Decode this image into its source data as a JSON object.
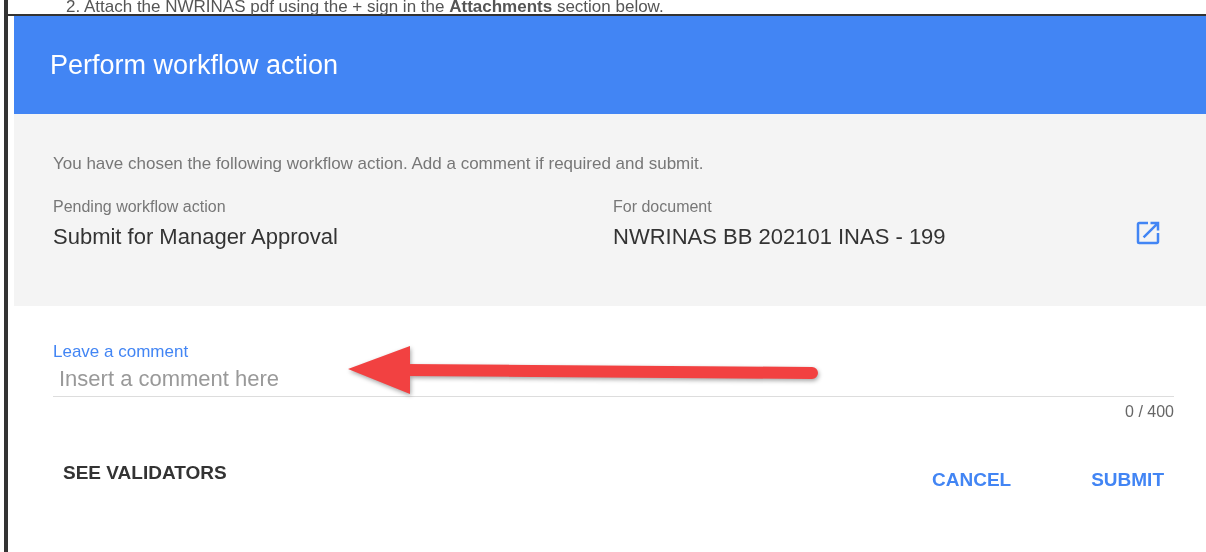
{
  "background_text": "2. Attach the NWRINAS pdf using the + sign in the **Attachments** section below.",
  "dialog": {
    "title": "Perform workflow action",
    "intro": "You have chosen the following workflow action. Add a comment if required and submit.",
    "details": [
      {
        "label": "Pending workflow action",
        "value": "Submit for Manager Approval",
        "kind": "text"
      },
      {
        "label": "For document",
        "value": "NWRINAS BB 202101 INAS - 199",
        "kind": "link"
      }
    ],
    "comment": {
      "label": "Leave a comment",
      "placeholder": "Insert a comment here",
      "counter": "0 / 400"
    },
    "buttons": [
      {
        "label": "SEE VALIDATORS",
        "kind": "secondary"
      },
      {
        "label": "CANCEL",
        "kind": "primary"
      },
      {
        "label": "SUBMIT",
        "kind": "primary"
      }
    ]
  }
}
